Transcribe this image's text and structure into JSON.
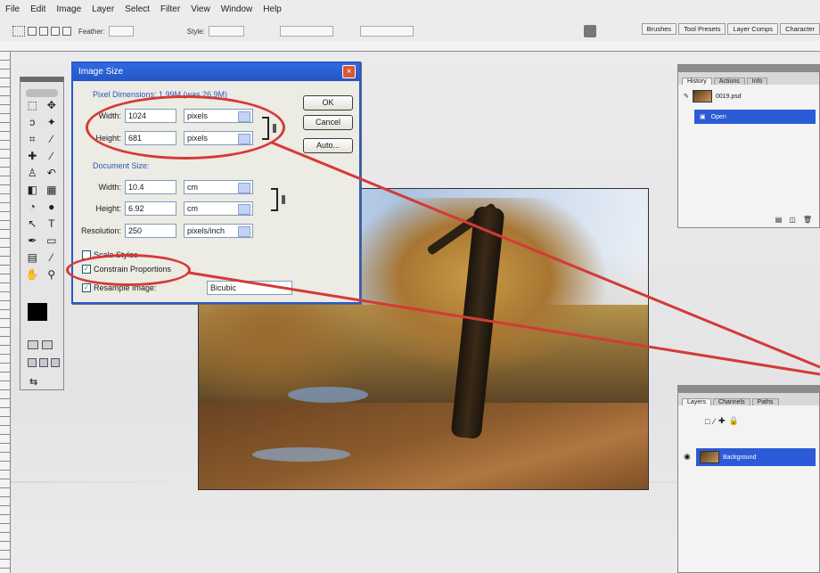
{
  "menu": {
    "items": [
      "File",
      "Edit",
      "Image",
      "Layer",
      "Select",
      "Filter",
      "View",
      "Window",
      "Help"
    ]
  },
  "options_bar": {
    "feather_label": "Feather:",
    "style_label": "Style:",
    "palette_tabs": [
      "Brushes",
      "Tool Presets",
      "Layer Comps",
      "Character"
    ]
  },
  "dialog": {
    "title": "Image Size",
    "close": "×",
    "pixel_dimensions_label": "Pixel Dimensions: 1.99M (was 26.9M)",
    "width_label": "Width:",
    "width_value": "1024",
    "width_unit": "pixels",
    "height_label": "Height:",
    "height_value": "681",
    "height_unit": "pixels",
    "document_size_label": "Document Size:",
    "doc_width_label": "Width:",
    "doc_width_value": "10.4",
    "doc_width_unit": "cm",
    "doc_height_label": "Height:",
    "doc_height_value": "6.92",
    "doc_height_unit": "cm",
    "resolution_label": "Resolution:",
    "resolution_value": "250",
    "resolution_unit": "pixels/inch",
    "scale_styles": "Scale Styles",
    "constrain_proportions": "Constrain Proportions",
    "resample_image": "Resample Image:",
    "resample_value": "Bicubic",
    "ok": "OK",
    "cancel": "Cancel",
    "auto": "Auto..."
  },
  "history_panel": {
    "tabs": [
      "History",
      "Actions",
      "Info"
    ],
    "snapshot_name": "0019.psd",
    "step": "Open"
  },
  "layers_panel": {
    "tabs": [
      "Layers",
      "Channels",
      "Paths"
    ],
    "layer_name": "Background"
  },
  "colors": {
    "annotation": "#d43a37",
    "titlebar": "#2f6ae0",
    "selection": "#2b5bd6"
  }
}
